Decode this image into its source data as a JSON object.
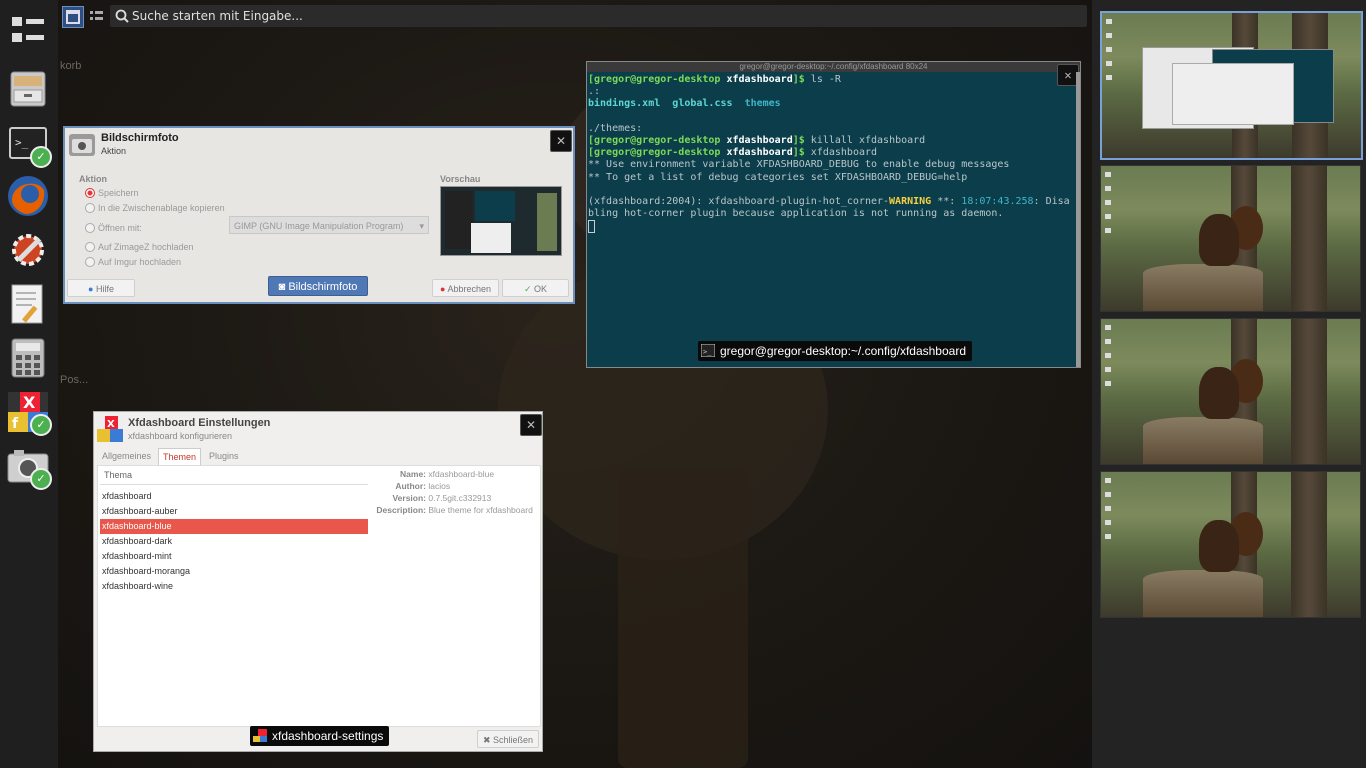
{
  "search": {
    "placeholder": "Suche starten mit Eingabe..."
  },
  "wallpaper_labels": {
    "a": "korb",
    "b": "Pos..."
  },
  "screenshot_dialog": {
    "title": "Bildschirmfoto",
    "subtitle": "Aktion",
    "section_action": "Aktion",
    "section_preview": "Vorschau",
    "options": [
      "Speichern",
      "In die Zwischenablage kopieren",
      "Öffnen mit:",
      "Auf ZimageZ hochladen",
      "Auf Imgur hochladen"
    ],
    "open_with_app": "GIMP (GNU Image Manipulation Program)",
    "help_label": "Hilfe",
    "screenshot_caption": "Bildschirmfoto",
    "cancel_label": "Abbrechen",
    "ok_label": "OK",
    "close_label": "✕"
  },
  "terminal": {
    "title": "gregor@gregor-desktop:~/.config/xfdashboard 80x24",
    "caption": "gregor@gregor-desktop:~/.config/xfdashboard",
    "prompt": "[gregor@gregor-desktop",
    "dir": "xfdashboard",
    "cmd1": "ls -R",
    "line_dot": ".:",
    "file1": "bindings.xml",
    "file2": "global.css",
    "file3": "themes",
    "line_themes": "./themes:",
    "cmd2": "killall xfdashboard",
    "cmd3": "xfdashboard",
    "msg1": "** Use environment variable XFDASHBOARD_DEBUG to enable debug messages",
    "msg2": "** To get a list of debug categories set XFDASHBOARD_DEBUG=help",
    "warn_pre": "(xfdashboard:2004): xfdashboard-plugin-hot_corner-",
    "warn_word": "WARNING",
    "warn_mid": " **: ",
    "warn_time": "18:07:43.258",
    "warn_post": ": Disa",
    "warn_line2": "bling hot-corner plugin because application is not running as daemon.",
    "close_label": "✕"
  },
  "settings_window": {
    "title": "Xfdashboard Einstellungen",
    "subtitle": "xfdashboard konfigurieren",
    "caption": "xfdashboard-settings",
    "tabs": [
      "Allgemeines",
      "Themen",
      "Plugins"
    ],
    "list_header": "Thema",
    "themes": [
      "xfdashboard",
      "xfdashboard-auber",
      "xfdashboard-blue",
      "xfdashboard-dark",
      "xfdashboard-mint",
      "xfdashboard-moranga",
      "xfdashboard-wine"
    ],
    "selected_theme": "xfdashboard-blue",
    "details": {
      "name_key": "Name:",
      "name_val": "xfdashboard-blue",
      "author_key": "Author:",
      "author_val": "lacios",
      "version_key": "Version:",
      "version_val": "0.7.5git.c332913",
      "desc_key": "Description:",
      "desc_val": "Blue theme for xfdashboard"
    },
    "close_button": "Schließen",
    "close_label": "✕"
  },
  "dock": {
    "items": [
      "windows-view-icon",
      "file-cabinet-icon",
      "terminal-icon",
      "firefox-icon",
      "settings-tools-icon",
      "text-editor-icon",
      "calculator-icon",
      "xfdashboard-settings-icon",
      "screenshot-icon"
    ]
  },
  "workspaces": {
    "count": 4,
    "active_index": 0
  },
  "colors": {
    "accent": "#6a8fbf",
    "selection": "#e9574c",
    "terminal_bg": "#0b3d4b",
    "prompt_green": "#7cd957"
  }
}
